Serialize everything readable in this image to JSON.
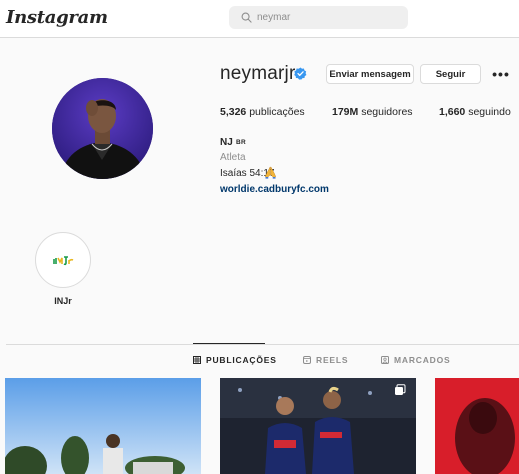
{
  "header": {
    "logo": "Instagram",
    "search": {
      "value": "neymar",
      "icon": "search-icon"
    }
  },
  "profile": {
    "username": "neymarjr",
    "verified_icon": "verified-badge-icon",
    "verified_color": "#3897f0",
    "buttons": {
      "message": "Enviar mensagem",
      "follow": "Seguir",
      "more": "•••"
    },
    "stats": {
      "posts_count": "5,326",
      "posts_label": "publicações",
      "followers_count": "179M",
      "followers_label": "seguidores",
      "following_count": "1,660",
      "following_label": "seguindo"
    },
    "full_name": "NJ",
    "flag_text": "BR",
    "category": "Atleta",
    "bio": "Isaías 54:17",
    "bio_emoji_icon": "praying-hands-icon",
    "link": "worldie.cadburyfc.com"
  },
  "highlights": [
    {
      "label": "INJr"
    }
  ],
  "tabs": [
    {
      "label": "PUBLICAÇÕES",
      "icon": "grid-icon",
      "active": true
    },
    {
      "label": "REELS",
      "icon": "reels-icon",
      "active": false
    },
    {
      "label": "MARCADOS",
      "icon": "tagged-icon",
      "active": false
    }
  ],
  "colors": {
    "link": "#00376b",
    "border": "#dbdbdb",
    "background": "#fafafa"
  }
}
